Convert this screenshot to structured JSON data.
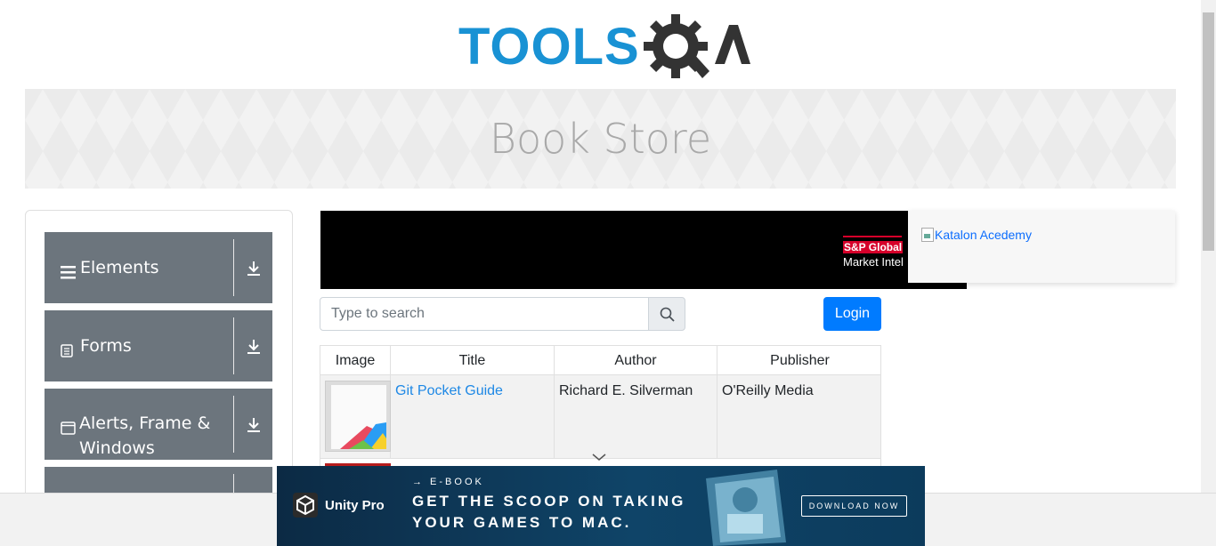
{
  "logo": {
    "text": "TOOLS",
    "icon": "toolsqa-gear-qa-logo"
  },
  "banner": {
    "title": "Book Store"
  },
  "sidebar": {
    "groups": [
      {
        "label": "Elements",
        "icon": "hamburger-icon"
      },
      {
        "label": "Forms",
        "icon": "document-icon"
      },
      {
        "label": "Alerts, Frame & Windows",
        "icon": "window-icon"
      },
      {
        "label": "",
        "icon": ""
      }
    ]
  },
  "ads": {
    "top_banner": {
      "brand_line1": "S&P Global",
      "brand_line2": "Market Intel"
    },
    "side_image_alt": "Katalon Acedemy",
    "bottom": {
      "brand": "Unity Pro",
      "kicker": "→ E-BOOK",
      "headline_line1": "GET THE SCOOP ON TAKING",
      "headline_line2": "YOUR GAMES TO MAC.",
      "cta": "DOWNLOAD NOW"
    }
  },
  "search": {
    "placeholder": "Type to search",
    "value": ""
  },
  "login": {
    "label": "Login"
  },
  "table": {
    "headers": [
      "Image",
      "Title",
      "Author",
      "Publisher"
    ],
    "rows": [
      {
        "title": "Git Pocket Guide",
        "author": "Richard E. Silverman",
        "publisher": "O'Reilly Media"
      }
    ]
  },
  "colors": {
    "brand_blue": "#1992d4",
    "menu_gray": "#6c757d",
    "login_blue": "#007bff",
    "link_blue": "#1e88e5"
  }
}
